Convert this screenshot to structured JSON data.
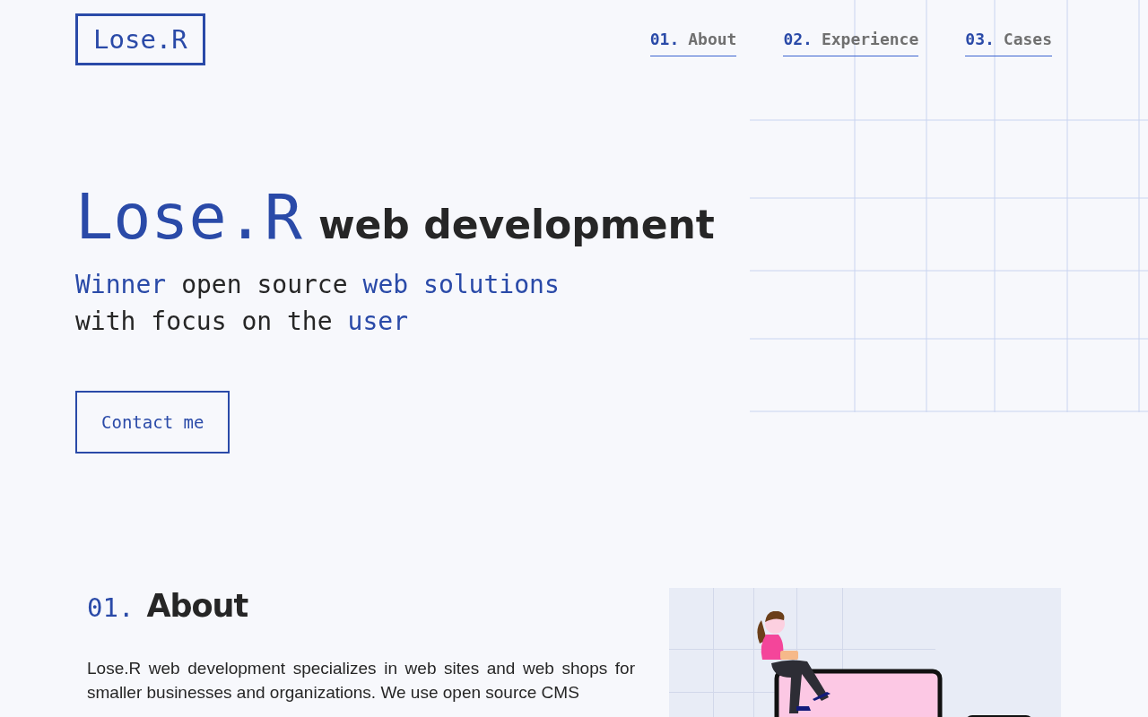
{
  "header": {
    "logo": "Lose.R",
    "nav": [
      {
        "number": "01.",
        "label": "About"
      },
      {
        "number": "02.",
        "label": "Experience"
      },
      {
        "number": "03.",
        "label": "Cases"
      }
    ]
  },
  "hero": {
    "brand": "Lose.R",
    "title": "web development",
    "subtitle_lines": [
      [
        {
          "text": "Winner",
          "highlight": true
        },
        {
          "text": "open source",
          "highlight": false
        },
        {
          "text": "web solutions",
          "highlight": true
        }
      ],
      [
        {
          "text": "with focus on the",
          "highlight": false
        },
        {
          "text": "user",
          "highlight": true
        }
      ]
    ],
    "button": "Contact me"
  },
  "about": {
    "number": "01.",
    "heading": "About",
    "paragraph": "Lose.R web development specializes in web sites and web shops for smaller businesses and organizations. We use open source CMS"
  }
}
